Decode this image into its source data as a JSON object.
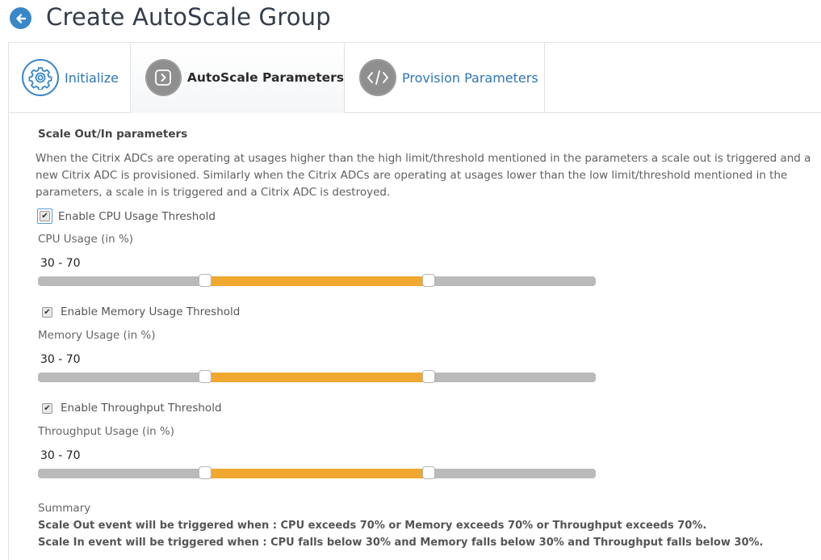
{
  "header": {
    "title": "Create AutoScale Group",
    "back_icon": "arrow-left-circle-icon"
  },
  "tabs": [
    {
      "label": "Initialize",
      "icon": "gear-icon",
      "active": false
    },
    {
      "label": "AutoScale Parameters",
      "icon": "chevron-right-square-icon",
      "active": true
    },
    {
      "label": "Provision Parameters",
      "icon": "code-icon",
      "active": false
    }
  ],
  "section": {
    "title": "Scale Out/In parameters",
    "description": "When the Citrix ADCs are operating at usages higher than the high limit/threshold mentioned in the parameters a scale out is triggered and a new Citrix ADC is provisioned. Similarly when the Citrix ADCs are operating at usages lower than the low limit/threshold mentioned in the parameters, a scale in is triggered and a Citrix ADC is destroyed."
  },
  "thresholds": [
    {
      "checkbox_label": "Enable CPU Usage Threshold",
      "checked": true,
      "field_label": "CPU Usage (in %)",
      "range_text": "30 - 70",
      "min": 0,
      "max": 100,
      "low": 30,
      "high": 70
    },
    {
      "checkbox_label": "Enable Memory Usage Threshold",
      "checked": true,
      "field_label": "Memory Usage (in %)",
      "range_text": "30 - 70",
      "min": 0,
      "max": 100,
      "low": 30,
      "high": 70
    },
    {
      "checkbox_label": "Enable Throughput Threshold",
      "checked": true,
      "field_label": "Throughput Usage (in %)",
      "range_text": "30 - 70",
      "min": 0,
      "max": 100,
      "low": 30,
      "high": 70
    }
  ],
  "summary": {
    "label": "Summary",
    "scale_out": "Scale Out event will be triggered when : CPU exceeds 70% or Memory exceeds 70% or Throughput exceeds 70%.",
    "scale_in": "Scale In event will be triggered when : CPU falls below 30% and Memory falls below 30% and Throughput falls below 30%."
  },
  "colors": {
    "accent_blue": "#3a87c8",
    "link_blue": "#2e75b6",
    "slider_fill": "#f0a830",
    "slider_track": "#bababa",
    "tab_icon_gray": "#8f8f8f"
  }
}
